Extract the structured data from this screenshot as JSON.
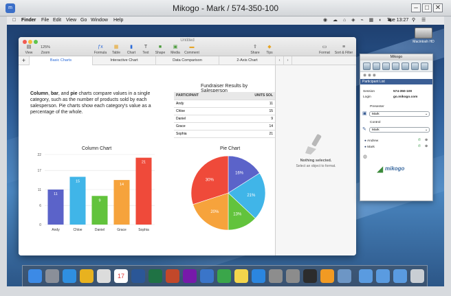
{
  "window": {
    "title": "Mikogo - Mark / 574-350-100"
  },
  "menubar": {
    "items": [
      "Finder",
      "File",
      "Edit",
      "View",
      "Go",
      "Window",
      "Help"
    ],
    "clock": "Tue 13:27"
  },
  "desktop": {
    "drive_label": "Macintosh HD"
  },
  "keynote": {
    "doc_title": "Untitled",
    "zoom_value": "125%",
    "toolbar": [
      {
        "label": "View",
        "icon": "view-icon"
      },
      {
        "label": "Zoom",
        "icon": "zoom-icon"
      },
      {
        "label": "Formula",
        "icon": "formula-icon"
      },
      {
        "label": "Table",
        "icon": "table-icon"
      },
      {
        "label": "Chart",
        "icon": "chart-icon"
      },
      {
        "label": "Text",
        "icon": "text-icon"
      },
      {
        "label": "Shape",
        "icon": "shape-icon"
      },
      {
        "label": "Media",
        "icon": "media-icon"
      },
      {
        "label": "Comment",
        "icon": "comment-icon"
      },
      {
        "label": "Share",
        "icon": "share-icon"
      },
      {
        "label": "Tips",
        "icon": "tips-icon"
      },
      {
        "label": "Format",
        "icon": "format-icon"
      },
      {
        "label": "Sort & Filter",
        "icon": "sort-filter-icon"
      }
    ],
    "tabs": [
      "Basic Charts",
      "Interactive Chart",
      "Data Comparison",
      "2-Axis Chart"
    ],
    "active_tab": 0,
    "intro_bold_1": "Column",
    "intro_sep_1": ", ",
    "intro_bold_2": "bar",
    "intro_sep_2": ", and ",
    "intro_bold_3": "pie",
    "intro_text": " charts compare values in a single category, such as the number of products sold by each salesperson. Pie charts show each category's value as a percentage of the whole.",
    "table": {
      "title": "Fundraiser Results by Salesperson",
      "headers": [
        "PARTICIPANT",
        "UNITS SOL"
      ],
      "rows": [
        [
          "Andy",
          "11"
        ],
        [
          "Chloe",
          "15"
        ],
        [
          "Daniel",
          "9"
        ],
        [
          "Grace",
          "14"
        ],
        [
          "Sophia",
          "21"
        ]
      ]
    },
    "inspector": {
      "title": "Nothing selected.",
      "subtitle": "Select an object to format."
    }
  },
  "chart_data": [
    {
      "type": "bar",
      "title": "Column Chart",
      "categories": [
        "Andy",
        "Chloe",
        "Daniel",
        "Grace",
        "Sophia"
      ],
      "values": [
        11,
        15,
        9,
        14,
        21
      ],
      "ylim": [
        0,
        20
      ],
      "yticks": [
        0,
        6,
        11,
        17,
        22
      ],
      "colors": [
        "#5b63c9",
        "#40b5e8",
        "#62c33c",
        "#f6a33c",
        "#ef4a3a"
      ]
    },
    {
      "type": "pie",
      "title": "Pie Chart",
      "categories": [
        "Andy",
        "Chloe",
        "Daniel",
        "Grace",
        "Sophia"
      ],
      "values": [
        16,
        21,
        13,
        20,
        30
      ],
      "labels": [
        "16%",
        "21%",
        "13%",
        "20%",
        "30%"
      ],
      "colors": [
        "#5b63c9",
        "#40b5e8",
        "#62c33c",
        "#f6a33c",
        "#ef4a3a"
      ]
    }
  ],
  "mikogo": {
    "title": "Mikogo",
    "participant_list": "Participant List",
    "session_label": "Session",
    "session_value": "574-350-100",
    "login_label": "Login",
    "login_value": "go.mikogo.com",
    "presenter_label": "Presenter",
    "presenter_value": "Mark",
    "control_label": "Control",
    "control_value": "Mark",
    "participants": [
      "Andrew",
      "Mark"
    ],
    "logo": "mikogo"
  },
  "dock": {
    "apps": [
      "finder",
      "launchpad",
      "safari",
      "chrome",
      "photos",
      "calendar",
      "word",
      "excel",
      "powerpoint",
      "onenote",
      "keynote",
      "numbers",
      "notes",
      "app-store",
      "preferences",
      "utility",
      "terminal",
      "pages",
      "preview",
      "folder",
      "folder",
      "folder",
      "trash"
    ],
    "calendar_day": "17"
  }
}
